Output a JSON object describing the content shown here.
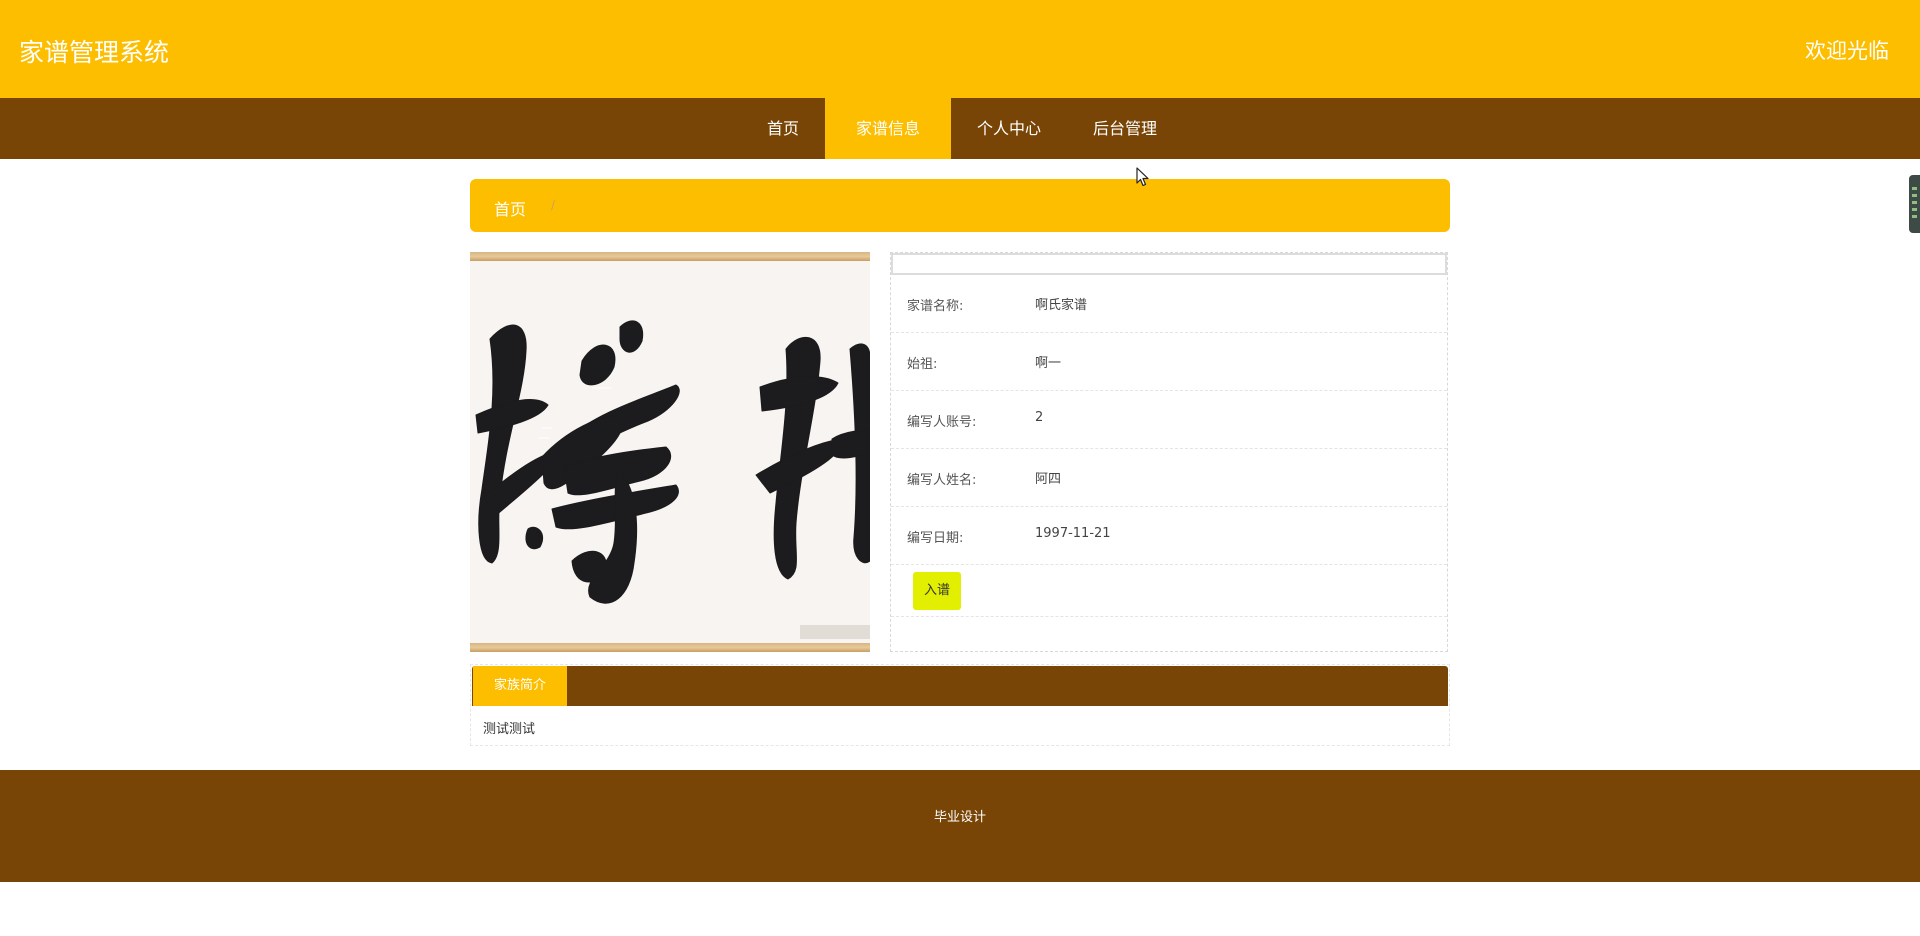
{
  "header": {
    "site_title": "家谱管理系统",
    "welcome": "欢迎光临"
  },
  "nav": {
    "items": [
      {
        "label": "首页",
        "active": false
      },
      {
        "label": "家谱信息",
        "active": true
      },
      {
        "label": "个人中心",
        "active": false
      },
      {
        "label": "后台管理",
        "active": false
      }
    ]
  },
  "breadcrumb": {
    "home": "首页",
    "separator": "/"
  },
  "detail": {
    "fields": [
      {
        "label": "家谱名称:",
        "value": "啊氏家谱"
      },
      {
        "label": "始祖:",
        "value": "啊一"
      },
      {
        "label": "编写人账号:",
        "value": "2"
      },
      {
        "label": "编写人姓名:",
        "value": "阿四"
      },
      {
        "label": "编写日期:",
        "value": "1997-11-21"
      }
    ],
    "join_button": "入谱"
  },
  "intro": {
    "tab_label": "家族简介",
    "text": "测试测试"
  },
  "footer": {
    "text": "毕业设计"
  },
  "colors": {
    "accent_yellow": "#fdbe00",
    "brown": "#794506",
    "join_button": "#e2ef00"
  },
  "icons": {
    "cursor": "mouse-pointer-icon",
    "side_widget": "side-toolbar-icon"
  }
}
